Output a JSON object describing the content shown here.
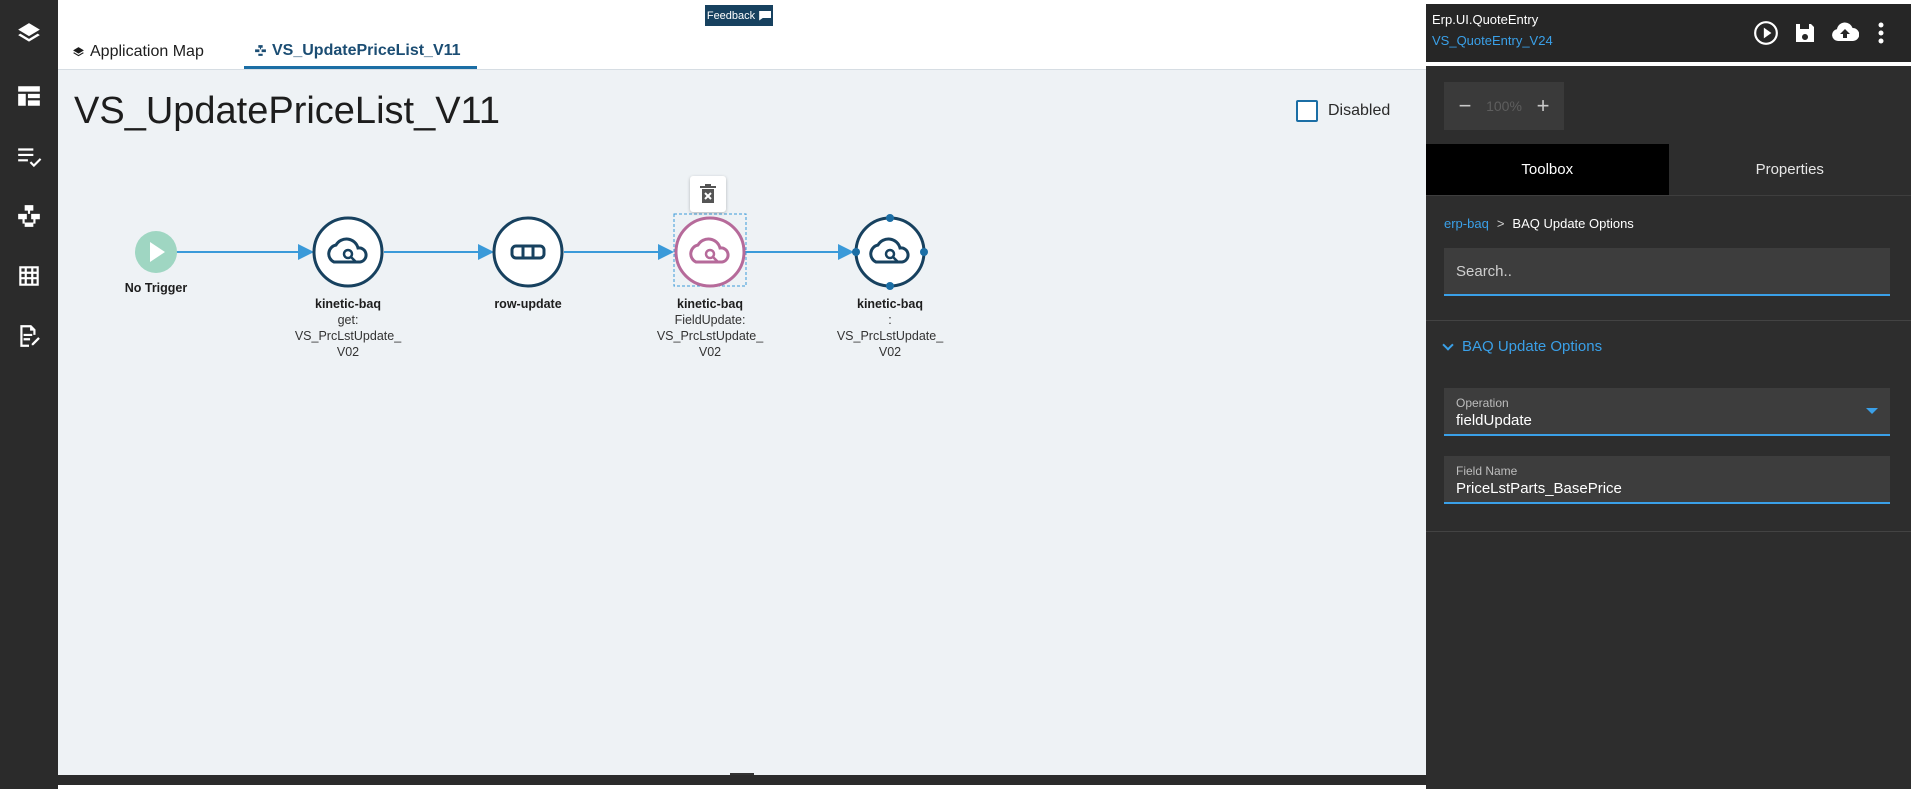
{
  "rail": {
    "icons": [
      "layers-icon",
      "layout-icon",
      "checklist-icon",
      "workflow-icon",
      "grid-icon",
      "edit-doc-icon"
    ]
  },
  "topbar": {
    "feedback_label": "Feedback",
    "tabs": [
      {
        "label": "Application Map",
        "icon": "layers-icon"
      },
      {
        "label": "VS_UpdatePriceList_V11",
        "icon": "workflow-icon",
        "active": true
      }
    ]
  },
  "canvas": {
    "title": "VS_UpdatePriceList_V11",
    "disabled_label": "Disabled",
    "disabled_checked": false,
    "nodes": [
      {
        "id": "trigger",
        "title": "No Trigger",
        "lines": []
      },
      {
        "id": "baq-get",
        "title": "kinetic-baq",
        "lines": [
          "get:",
          "VS_PrcLstUpdate_",
          "V02"
        ]
      },
      {
        "id": "row-update",
        "title": "row-update",
        "lines": []
      },
      {
        "id": "baq-fieldupdate",
        "title": "kinetic-baq",
        "lines": [
          "FieldUpdate:",
          "VS_PrcLstUpdate_",
          "V02"
        ],
        "selected": true
      },
      {
        "id": "baq-last",
        "title": "kinetic-baq",
        "lines": [
          ":",
          "VS_PrcLstUpdate_",
          "V02"
        ]
      }
    ]
  },
  "right_panel": {
    "app_name": "Erp.UI.QuoteEntry",
    "view_name": "VS_QuoteEntry_V24",
    "actions": [
      "play-icon",
      "save-icon",
      "upload-icon",
      "more-icon"
    ],
    "zoom": {
      "value": "100%",
      "minus": "−",
      "plus": "+"
    },
    "tabs": [
      {
        "label": "Toolbox",
        "active": true
      },
      {
        "label": "Properties",
        "active": false
      }
    ],
    "breadcrumb": {
      "link": "erp-baq",
      "sep": ">",
      "current": "BAQ Update Options"
    },
    "search_placeholder": "Search..",
    "section_title": "BAQ Update Options",
    "fields": [
      {
        "label": "Operation",
        "value": "fieldUpdate",
        "dropdown": true
      },
      {
        "label": "Field Name",
        "value": "PriceLstParts_BasePrice",
        "dropdown": false
      }
    ]
  },
  "colors": {
    "accent": "#3aa0e8",
    "node_stroke": "#17415f",
    "selected_node": "#b66a9a",
    "trigger": "#9fd6c2",
    "edge": "#3a9ad9"
  }
}
